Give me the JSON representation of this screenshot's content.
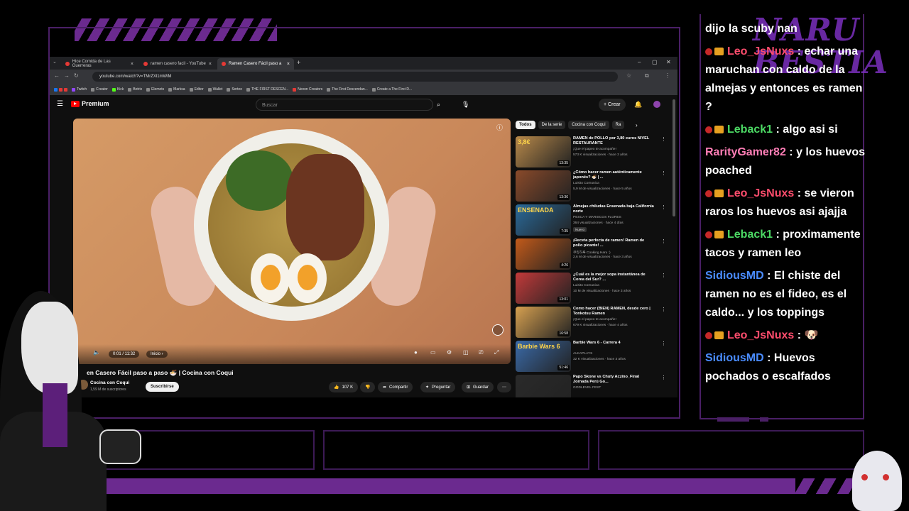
{
  "browser": {
    "tabs": [
      {
        "label": "Hice Comida de Las Guerreras",
        "active": false
      },
      {
        "label": "ramen casero facil - YouTube",
        "active": false
      },
      {
        "label": "Ramen Casero Fácil paso a",
        "active": true
      }
    ],
    "url": "youtube.com/watch?v=TMrZXl1mWiM",
    "bookmarks": [
      "Twitch",
      "Creator",
      "Kick",
      "Botrix",
      "Elemots",
      "Marksa",
      "Editor",
      "Wallet",
      "Sorteo",
      "THE FIRST DESCEN...",
      "Nexon Creators",
      "The First Descendan...",
      "Create a The First D..."
    ]
  },
  "youtube": {
    "logo_text": "Premium",
    "search_placeholder": "Buscar",
    "create_label": "+ Crear",
    "video": {
      "time": "0:01 / 11:32",
      "chapter": "Inicio ›",
      "title": "en Casero Fácil paso a paso 🍜 | Cocina con Coqui",
      "channel": "Cocina con Coqui",
      "subscribers": "1,59 M de suscriptores",
      "subscribe_label": "Suscribirse",
      "likes": "107 K",
      "share_label": "Compartir",
      "ask_label": "Preguntar",
      "save_label": "Guardar"
    },
    "chips": [
      "Todos",
      "De la serie",
      "Cocina con Coqui",
      "Ra"
    ],
    "recommendations": [
      {
        "title": "RAMEN de POLLO por 3,80 euros NIVEL RESTAURANTE",
        "channel": "¡Que el papeo te acompañe!",
        "meta": "573 K visualizaciones · hace 3 años",
        "duration": "13:35",
        "thumb_text": "3,8€",
        "color": "#b8894a"
      },
      {
        "title": "¿Cómo hacer ramen auténticamente japonés? 🍜 | ...",
        "channel": "Luisito Comunica",
        "meta": "5,9 M de visualizaciones · hace 5 años",
        "duration": "13:36",
        "thumb_text": "",
        "color": "#8a4a2a"
      },
      {
        "title": "Almejas chiludas Ensenada baja California norte",
        "channel": "PESCA Y MARISCOS FLORES",
        "meta": "364 visualizaciones · hace 4 días",
        "badge": "Nuevo",
        "duration": "7:35",
        "thumb_text": "ENSENADA",
        "color": "#2a6a9a"
      },
      {
        "title": "¡Receta perfecta de ramen! Ramen de pollo picante! ...",
        "channel": "쿠킹하루 Cooking Haru :)",
        "meta": "2,6 M de visualizaciones · hace 3 años",
        "duration": "4:26",
        "thumb_text": "",
        "color": "#c25a1a"
      },
      {
        "title": "¿Cuál es la mejor sopa instantánea de Corea del Sur? ...",
        "channel": "Luisito Comunica",
        "meta": "10 M de visualizaciones · hace 3 años",
        "duration": "13:01",
        "thumb_text": "",
        "color": "#c23a3a"
      },
      {
        "title": "Como hacer (BIEN) RAMEN, desde cero | Tonkotsu Ramen",
        "channel": "¡Que el papeo te acompañe!",
        "meta": "679 K visualizaciones · hace 4 años",
        "duration": "16:58",
        "thumb_text": "",
        "color": "#d6a050"
      },
      {
        "title": "Barbie Wars 6 - Carrera 4",
        "channel": "ALKAPLAYS",
        "meta": "32 K visualizaciones · hace 3 años",
        "duration": "51:46",
        "thumb_text": "Barbie Wars 6",
        "color": "#3a6aa8"
      },
      {
        "title": "Papo Skone vs Chuty Aczino_Final Jornada Perú Go...",
        "channel": "GODLEVEL FEST",
        "meta": "",
        "duration": "",
        "thumb_text": "",
        "color": "#2a2a2a"
      }
    ]
  },
  "chat": {
    "brand": "NARU BESTIA",
    "messages": [
      {
        "user": "",
        "badges": false,
        "user_color": "#ff4d6d",
        "text": "dijo la scuby nan"
      },
      {
        "user": "Leo_JsNuxs",
        "badges": true,
        "user_color": "#ff4d6d",
        "text": "echar una maruchan con caldo de la almejas y entonces es ramen ?"
      },
      {
        "user": "Leback1",
        "badges": true,
        "user_color": "#4cd964",
        "text": "algo asi si"
      },
      {
        "user": "RarityGamer82",
        "badges": false,
        "user_color": "#ff7eb6",
        "text": "y los huevos poached"
      },
      {
        "user": "Leo_JsNuxs",
        "badges": true,
        "user_color": "#ff4d6d",
        "text": "se vieron raros los huevos asi ajajja"
      },
      {
        "user": "Leback1",
        "badges": true,
        "user_color": "#4cd964",
        "text": "proximamente tacos y ramen leo"
      },
      {
        "user": "SidiousMD",
        "badges": false,
        "user_color": "#4a8cff",
        "text": "El chiste del ramen no es el fideo, es el caldo... y los toppings"
      },
      {
        "user": "Leo_JsNuxs",
        "badges": true,
        "user_color": "#ff4d6d",
        "text": "🐶"
      },
      {
        "user": "SidiousMD",
        "badges": false,
        "user_color": "#4a8cff",
        "text": "Huevos pochados o escalfados"
      }
    ]
  },
  "colors": {
    "accent": "#6b2a8f",
    "frame": "#4a1f66",
    "yt_red": "#ff0000"
  }
}
